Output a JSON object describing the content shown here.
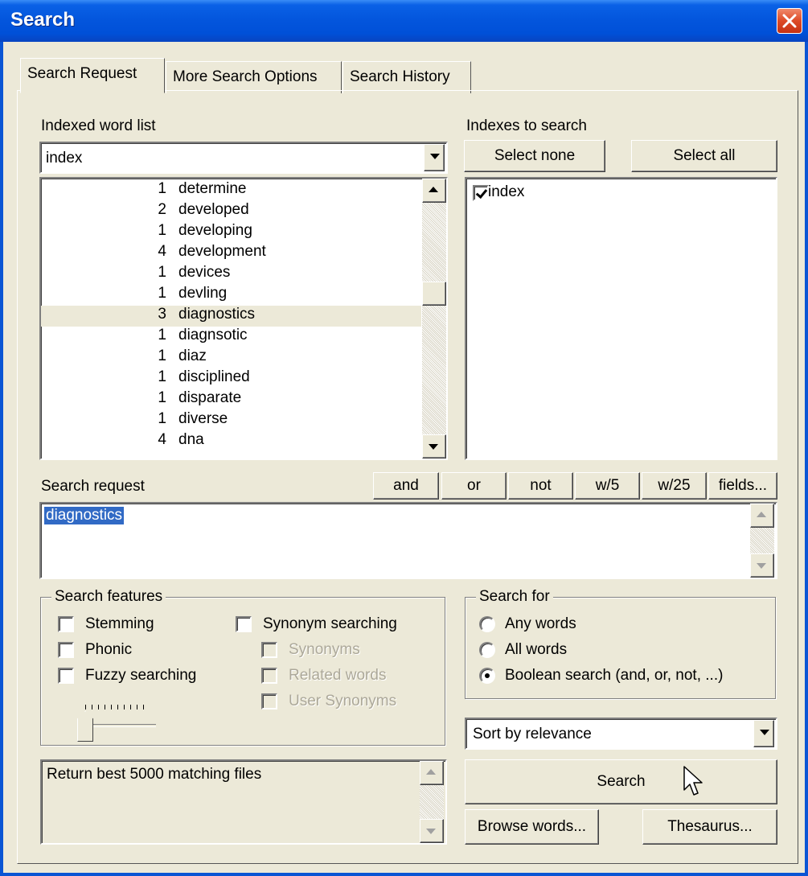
{
  "window": {
    "title": "Search"
  },
  "tabs": [
    "Search Request",
    "More Search Options",
    "Search History"
  ],
  "indexed_word_list": {
    "label": "Indexed word list",
    "selected_index": "index",
    "words": [
      {
        "count": "1",
        "word": "determine"
      },
      {
        "count": "2",
        "word": "developed"
      },
      {
        "count": "1",
        "word": "developing"
      },
      {
        "count": "4",
        "word": "development"
      },
      {
        "count": "1",
        "word": "devices"
      },
      {
        "count": "1",
        "word": "devling"
      },
      {
        "count": "3",
        "word": "diagnostics"
      },
      {
        "count": "1",
        "word": "diagnsotic"
      },
      {
        "count": "1",
        "word": "diaz"
      },
      {
        "count": "1",
        "word": "disciplined"
      },
      {
        "count": "1",
        "word": "disparate"
      },
      {
        "count": "1",
        "word": "diverse"
      },
      {
        "count": "4",
        "word": "dna"
      }
    ],
    "highlighted_word": "diagnostics"
  },
  "indexes_to_search": {
    "label": "Indexes to search",
    "select_none": "Select none",
    "select_all": "Select all",
    "items": [
      {
        "label": "index",
        "checked": true
      }
    ]
  },
  "search_request": {
    "label": "Search request",
    "operators": [
      "and",
      "or",
      "not",
      "w/5",
      "w/25",
      "fields..."
    ],
    "text": "diagnostics"
  },
  "search_features": {
    "title": "Search features",
    "stemming": "Stemming",
    "phonic": "Phonic",
    "fuzzy": "Fuzzy searching",
    "synonym_searching": "Synonym searching",
    "synonyms": "Synonyms",
    "related_words": "Related words",
    "user_synonyms": "User Synonyms",
    "fuzzy_level": 0.0
  },
  "search_for": {
    "title": "Search for",
    "options": [
      "Any words",
      "All words",
      "Boolean search (and, or, not, ...)"
    ],
    "selected": "Boolean search (and, or, not, ...)"
  },
  "sort": {
    "selected": "Sort by relevance"
  },
  "results_info": "Return best 5000 matching files",
  "buttons": {
    "search": "Search",
    "browse_words": "Browse words...",
    "thesaurus": "Thesaurus..."
  }
}
